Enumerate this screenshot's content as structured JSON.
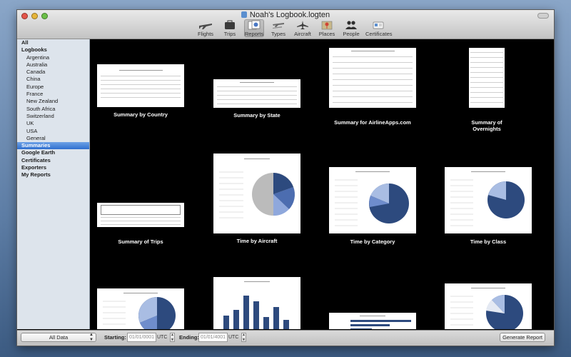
{
  "window": {
    "title": "Noah's Logbook.logten"
  },
  "toolbar": {
    "items": [
      {
        "label": "Flights"
      },
      {
        "label": "Trips"
      },
      {
        "label": "Reports"
      },
      {
        "label": "Types"
      },
      {
        "label": "Aircraft"
      },
      {
        "label": "Places"
      },
      {
        "label": "People"
      },
      {
        "label": "Certificates"
      }
    ],
    "selected": "Reports"
  },
  "sidebar": {
    "items": [
      {
        "label": "All"
      },
      {
        "label": "Logbooks"
      },
      {
        "label": "Argentina"
      },
      {
        "label": "Australia"
      },
      {
        "label": "Canada"
      },
      {
        "label": "China"
      },
      {
        "label": "Europe"
      },
      {
        "label": "France"
      },
      {
        "label": "New Zealand"
      },
      {
        "label": "South Africa"
      },
      {
        "label": "Switzerland"
      },
      {
        "label": "UK"
      },
      {
        "label": "USA"
      },
      {
        "label": "General"
      },
      {
        "label": "Summaries"
      },
      {
        "label": "Google Earth"
      },
      {
        "label": "Certificates"
      },
      {
        "label": "Exporters"
      },
      {
        "label": "My Reports"
      }
    ],
    "selected": "Summaries"
  },
  "reports": [
    {
      "caption": "Summary by Country"
    },
    {
      "caption": "Summary by State"
    },
    {
      "caption": "Summary for AirlineApps.com"
    },
    {
      "caption": "Summary of Overnights"
    },
    {
      "caption": "Summary of Trips"
    },
    {
      "caption": "Time by Aircraft"
    },
    {
      "caption": "Time by Category"
    },
    {
      "caption": "Time by Class"
    },
    {
      "caption": ""
    },
    {
      "caption": ""
    },
    {
      "caption": ""
    },
    {
      "caption": ""
    }
  ],
  "bottom": {
    "filter": "All Data",
    "starting_label": "Starting:",
    "starting_value": "01/01/0001",
    "starting_tz": "UTC",
    "ending_label": "Ending:",
    "ending_value": "01/01/4001",
    "ending_tz": "UTC",
    "generate_button": "Generate Report"
  },
  "colors": {
    "accent": "#2f6fcf",
    "chart_dark": "#2d4a7e",
    "chart_light": "#a9bde3"
  }
}
